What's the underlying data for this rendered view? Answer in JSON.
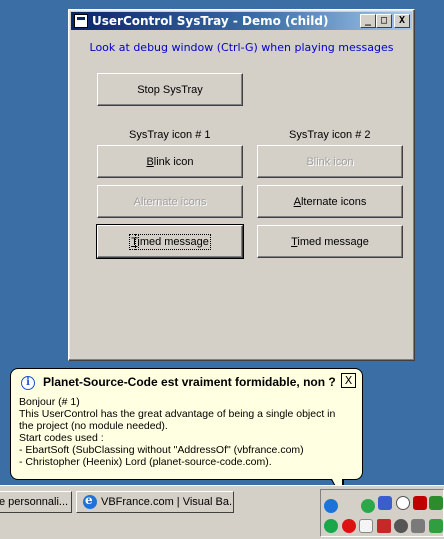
{
  "window": {
    "title": "UserControl SysTray - Demo (child)",
    "minimize": "_",
    "maximize": "□",
    "close": "X",
    "hint": "Look at debug window (Ctrl-G) when playing messages"
  },
  "buttons": {
    "stop": "Stop SysTray",
    "blink1_u": "B",
    "blink1_rest": "link icon",
    "alt1": "Alternate icons",
    "timed1_u": "T",
    "timed1_rest": "imed message",
    "blink2": "Blink icon",
    "alt2_u": "A",
    "alt2_rest": "lternate icons",
    "timed2_u": "T",
    "timed2_rest": "imed message"
  },
  "groups": {
    "icon1": "SysTray icon # 1",
    "icon2": "SysTray icon # 2"
  },
  "balloon": {
    "title": "Planet-Source-Code est vraiment formidable, non ?",
    "close": "X",
    "lines": [
      "Bonjour (# 1)",
      "This UserControl has the great advantage of being a single object in",
      "the project (no module needed).",
      "Start codes used :",
      "- EbartSoft (SubClassing without \"AddressOf\" (vbfrance.com)",
      "- Christopher (Heenix) Lord (planet-source-code.com)."
    ]
  },
  "taskbar": {
    "item1": "e personnali...",
    "item2": "VBFrance.com | Visual Ba..."
  },
  "colors": {
    "desktop": "#3a6ea5",
    "face": "#d4d0c8",
    "hint": "#0000cc",
    "balloon_bg": "#ffffe1"
  }
}
